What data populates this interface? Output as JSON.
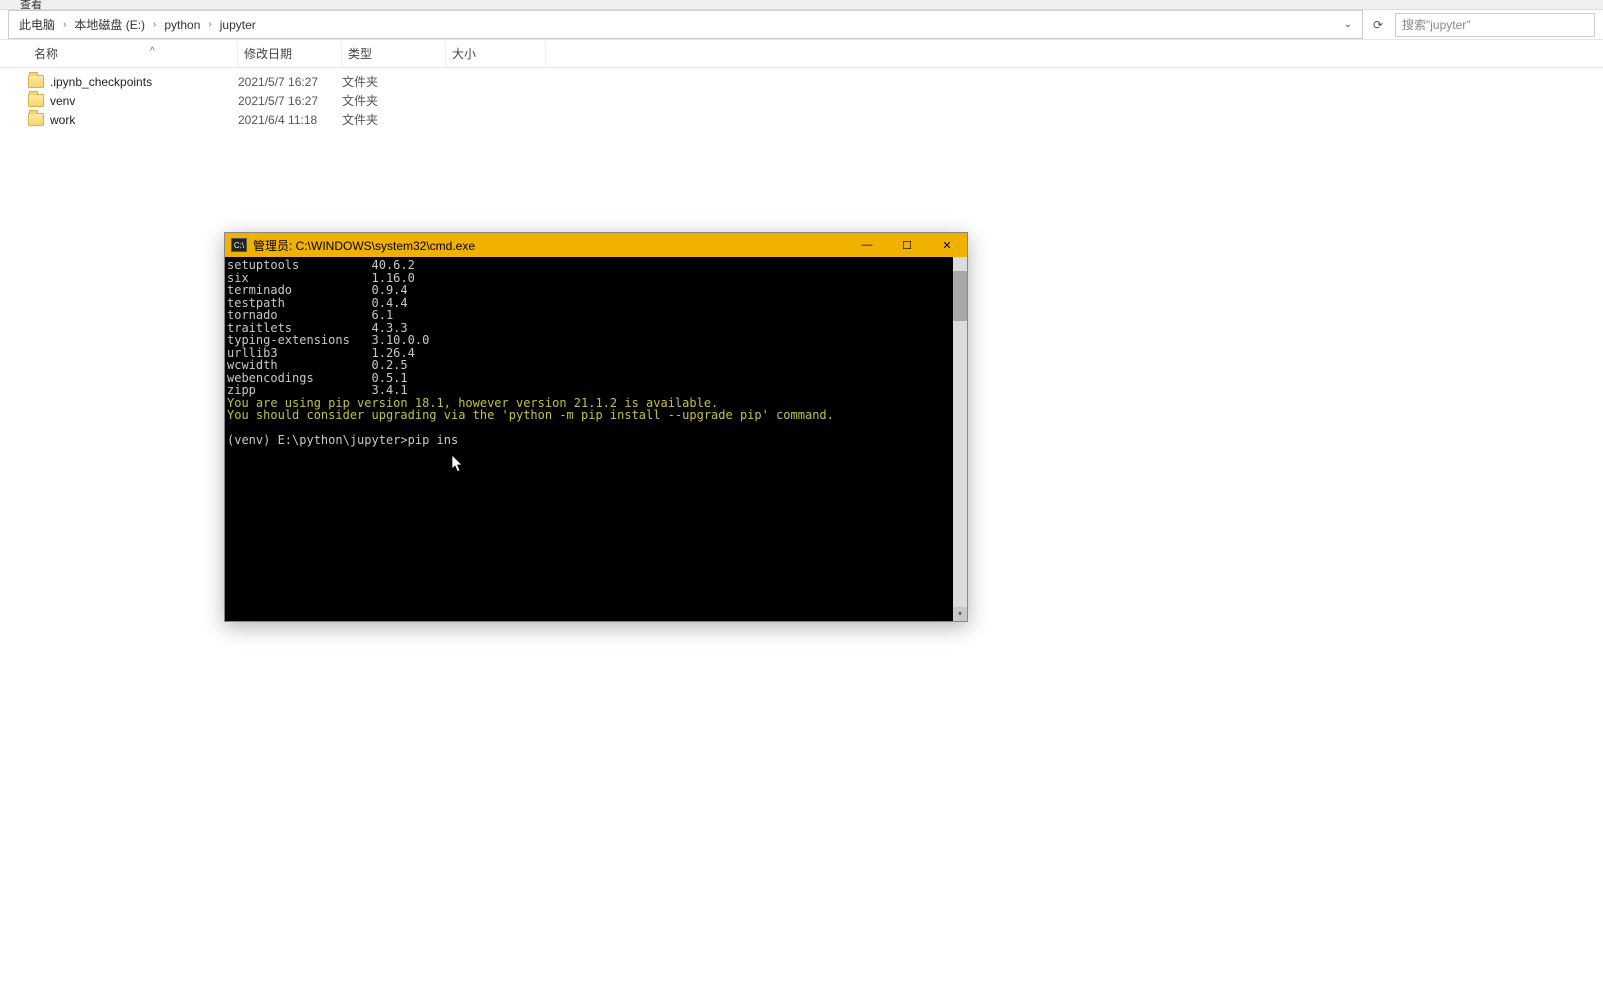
{
  "tab_label": "查看",
  "breadcrumb": {
    "root": "此电脑",
    "drive": "本地磁盘 (E:)",
    "folder1": "python",
    "folder2": "jupyter"
  },
  "search_placeholder": "搜索\"jupyter\"",
  "columns": {
    "name": "名称",
    "date": "修改日期",
    "type": "类型",
    "size": "大小"
  },
  "files": [
    {
      "name": ".ipynb_checkpoints",
      "date": "2021/5/7 16:27",
      "type": "文件夹",
      "size": ""
    },
    {
      "name": "venv",
      "date": "2021/5/7 16:27",
      "type": "文件夹",
      "size": ""
    },
    {
      "name": "work",
      "date": "2021/6/4 11:18",
      "type": "文件夹",
      "size": ""
    }
  ],
  "cmd": {
    "title": "管理员: C:\\WINDOWS\\system32\\cmd.exe",
    "icon_label": "C:\\",
    "packages": [
      {
        "name": "setuptools",
        "ver": "40.6.2"
      },
      {
        "name": "six",
        "ver": "1.16.0"
      },
      {
        "name": "terminado",
        "ver": "0.9.4"
      },
      {
        "name": "testpath",
        "ver": "0.4.4"
      },
      {
        "name": "tornado",
        "ver": "6.1"
      },
      {
        "name": "traitlets",
        "ver": "4.3.3"
      },
      {
        "name": "typing-extensions",
        "ver": "3.10.0.0"
      },
      {
        "name": "urllib3",
        "ver": "1.26.4"
      },
      {
        "name": "wcwidth",
        "ver": "0.2.5"
      },
      {
        "name": "webencodings",
        "ver": "0.5.1"
      },
      {
        "name": "zipp",
        "ver": "3.4.1"
      }
    ],
    "warn1": "You are using pip version 18.1, however version 21.1.2 is available.",
    "warn2": "You should consider upgrading via the 'python -m pip install --upgrade pip' command.",
    "prompt": "(venv) E:\\python\\jupyter>pip ins"
  }
}
